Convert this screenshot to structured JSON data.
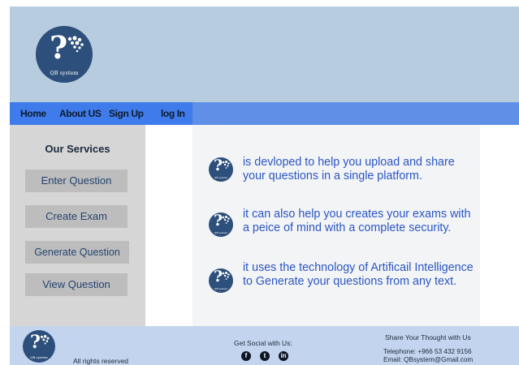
{
  "logo": {
    "text": "QB system"
  },
  "nav": {
    "items": [
      {
        "label": "Home"
      },
      {
        "label": "About US"
      },
      {
        "label": "Sign Up"
      },
      {
        "label": "log In"
      }
    ]
  },
  "services": {
    "title": "Our Services",
    "buttons": [
      {
        "label": "Enter Question"
      },
      {
        "label": "Create Exam"
      },
      {
        "label": "Generate Question"
      },
      {
        "label": "View Question"
      }
    ]
  },
  "features": [
    {
      "text": "is devloped to help you upload and share your questions in a single platform."
    },
    {
      "text": "it can also help you creates your exams with a peice of mind with a complete security."
    },
    {
      "text": "it uses the technology of Artificail Intelligence to Generate your questions from any text."
    }
  ],
  "footer": {
    "rights": "All rights reserved",
    "social_title": "Get Social with Us:",
    "social_icons": [
      "facebook-icon",
      "twitter-icon",
      "linkedin-icon"
    ],
    "share_title": "Share Your Thought with Us",
    "telephone": "Telephone: +966 53 432 9156",
    "email": "Email: QBsystem@Gmail.com"
  },
  "colors": {
    "header": "#b7ccdf",
    "nav": "#3f7bea",
    "sidebar": "#d6d6d6",
    "feature_text": "#2a56c3",
    "footer": "#c3d4ee",
    "logo": "#2d4f7b"
  }
}
